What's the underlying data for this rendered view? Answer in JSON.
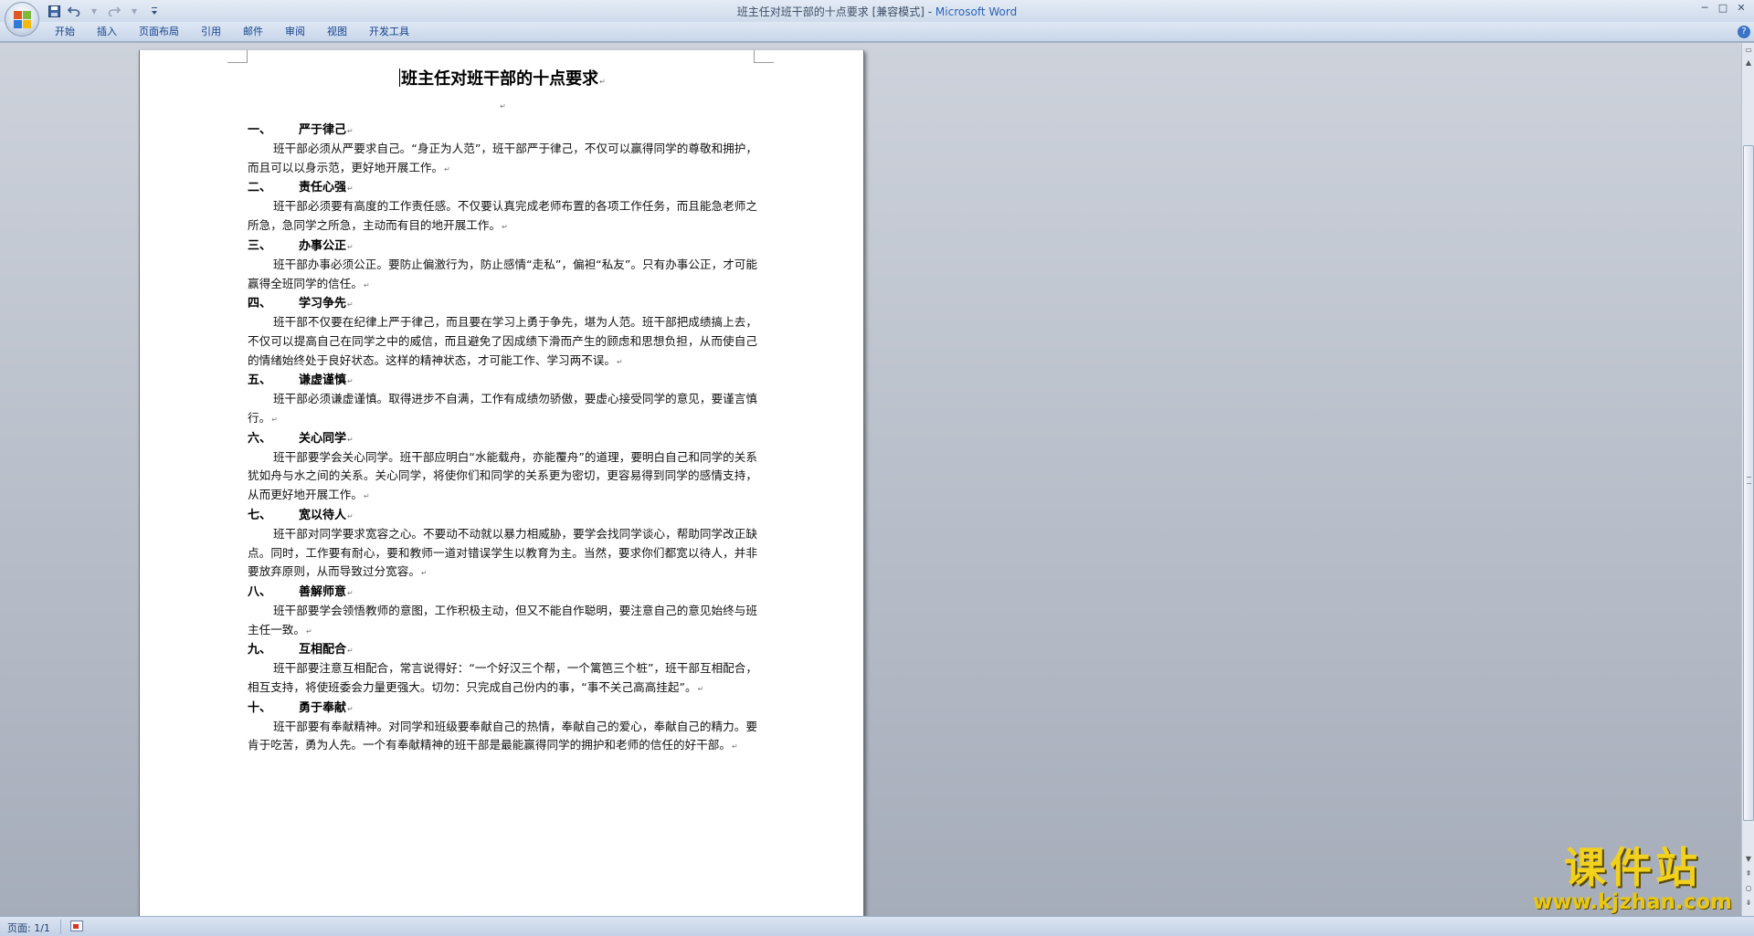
{
  "window": {
    "title_doc": "班主任对班干部的十点要求 [兼容模式] - ",
    "title_app": "Microsoft Word",
    "minimize": "─",
    "maximize": "□",
    "close": "✕"
  },
  "quick_access": {
    "save_icon": "save-icon",
    "undo_icon": "undo-icon",
    "redo_icon": "redo-icon",
    "customize_icon": "dropdown-icon"
  },
  "ribbon": {
    "tabs": [
      {
        "label": "开始"
      },
      {
        "label": "插入"
      },
      {
        "label": "页面布局"
      },
      {
        "label": "引用"
      },
      {
        "label": "邮件"
      },
      {
        "label": "审阅"
      },
      {
        "label": "视图"
      },
      {
        "label": "开发工具"
      }
    ],
    "help": "?"
  },
  "document": {
    "title": "班主任对班干部的十点要求",
    "paragraph_mark": "↵",
    "sections": [
      {
        "num": "一、",
        "heading": "严于律己",
        "body": "班干部必须从严要求自己。“身正为人范”，班干部严于律己，不仅可以赢得同学的尊敬和拥护，而且可以以身示范，更好地开展工作。"
      },
      {
        "num": "二、",
        "heading": "责任心强",
        "body": "班干部必须要有高度的工作责任感。不仅要认真完成老师布置的各项工作任务，而且能急老师之所急，急同学之所急，主动而有目的地开展工作。"
      },
      {
        "num": "三、",
        "heading": "办事公正",
        "body": "班干部办事必须公正。要防止偏激行为，防止感情“走私”，偏袒“私友”。只有办事公正，才可能赢得全班同学的信任。"
      },
      {
        "num": "四、",
        "heading": "学习争先",
        "body": "班干部不仅要在纪律上严于律己，而且要在学习上勇于争先，堪为人范。班干部把成绩搞上去，不仅可以提高自己在同学之中的威信，而且避免了因成绩下滑而产生的顾虑和思想负担，从而使自己的情绪始终处于良好状态。这样的精神状态，才可能工作、学习两不误。"
      },
      {
        "num": "五、",
        "heading": "谦虚谨慎",
        "body": "班干部必须谦虚谨慎。取得进步不自满，工作有成绩勿骄傲，要虚心接受同学的意见，要谨言慎行。"
      },
      {
        "num": "六、",
        "heading": "关心同学",
        "body": "班干部要学会关心同学。班干部应明白“水能载舟，亦能覆舟”的道理，要明白自己和同学的关系犹如舟与水之间的关系。关心同学，将使你们和同学的关系更为密切，更容易得到同学的感情支持，从而更好地开展工作。"
      },
      {
        "num": "七、",
        "heading": "宽以待人",
        "body": "班干部对同学要求宽容之心。不要动不动就以暴力相威胁，要学会找同学谈心，帮助同学改正缺点。同时，工作要有耐心，要和教师一道对错误学生以教育为主。当然，要求你们都宽以待人，并非要放弃原则，从而导致过分宽容。"
      },
      {
        "num": "八、",
        "heading": "善解师意",
        "body": "班干部要学会领悟教师的意图，工作积极主动，但又不能自作聪明，要注意自己的意见始终与班主任一致。"
      },
      {
        "num": "九、",
        "heading": "互相配合",
        "body": "班干部要注意互相配合，常言说得好：“一个好汉三个帮，一个篱笆三个桩”，班干部互相配合，相互支持，将使班委会力量更强大。切勿：只完成自己份内的事，“事不关己高高挂起”。"
      },
      {
        "num": "十、",
        "heading": "勇于奉献",
        "body": "班干部要有奉献精神。对同学和班级要奉献自己的热情，奉献自己的爱心，奉献自己的精力。要肯于吃苦，勇为人先。一个有奉献精神的班干部是最能赢得同学的拥护和老师的信任的好干部。"
      }
    ]
  },
  "statusbar": {
    "page_info": "页面: 1/1",
    "proofing_icon": "proofing-icon"
  },
  "watermark": {
    "text": "课件站",
    "url": "www.kjzhan.com"
  },
  "colors": {
    "accent": "#2b63b5",
    "ribbon_text": "#15428b",
    "watermark_yellow": "#f1d11b"
  }
}
